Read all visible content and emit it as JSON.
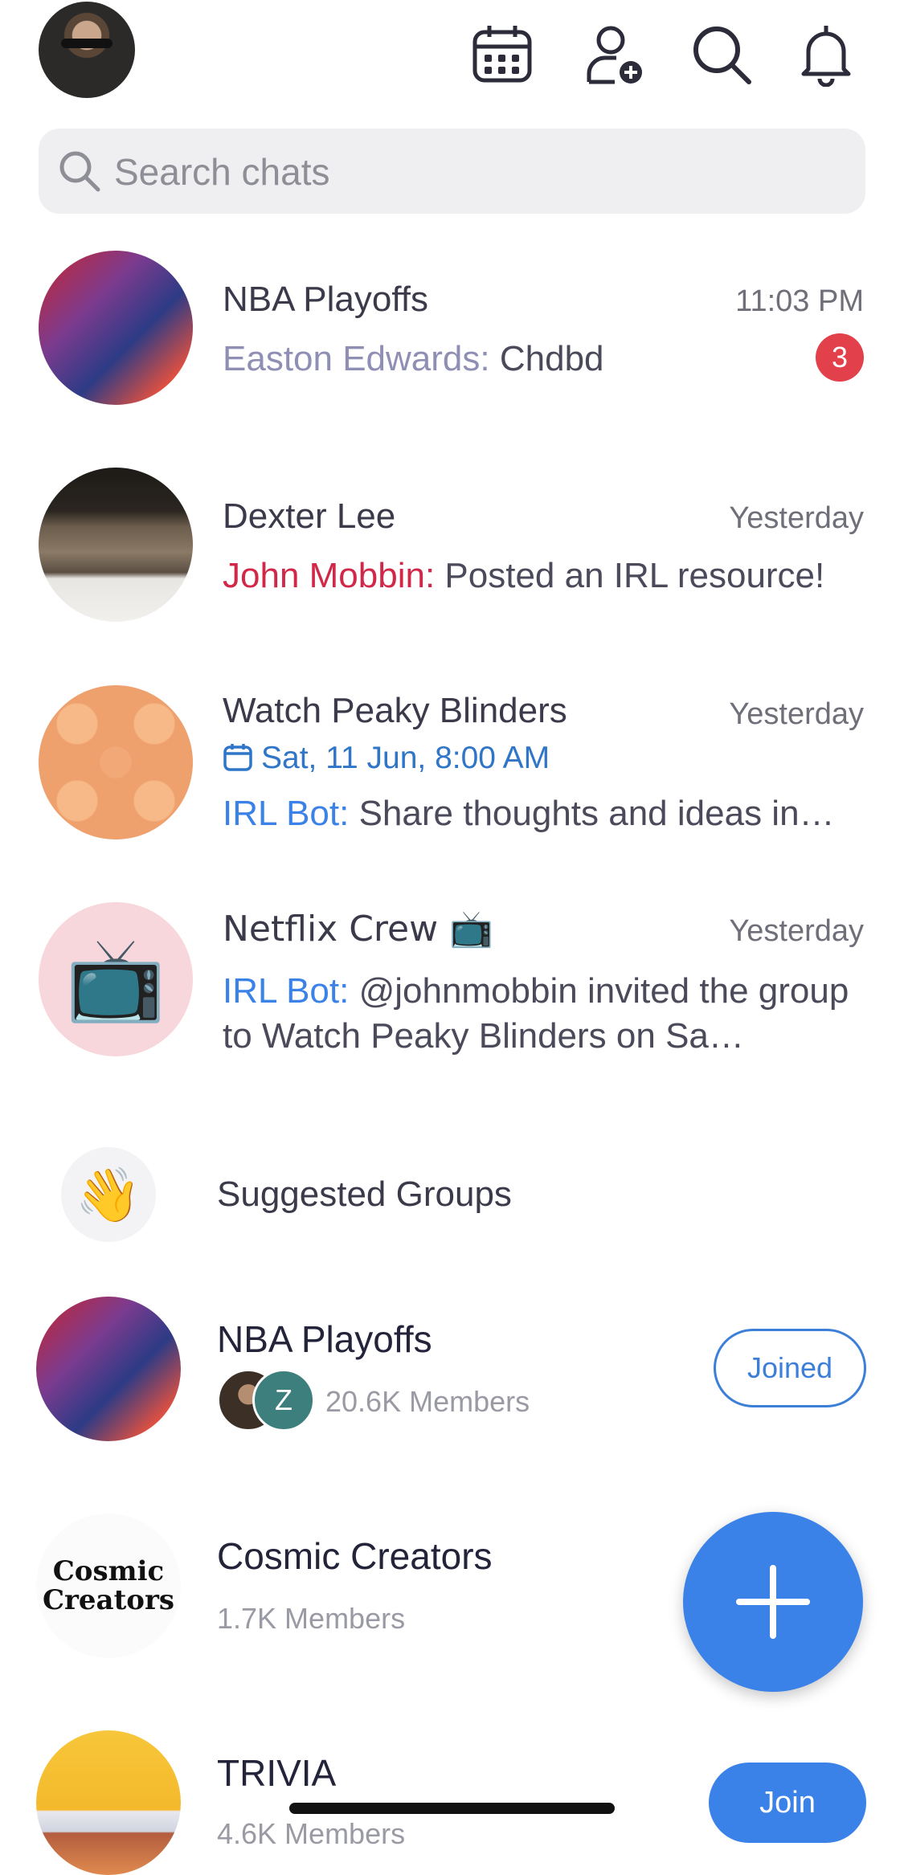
{
  "header": {
    "icons": [
      "calendar-icon",
      "add-user-icon",
      "search-icon",
      "bell-icon"
    ]
  },
  "search": {
    "placeholder": "Search chats"
  },
  "chats": [
    {
      "title": "NBA Playoffs",
      "time": "11:03 PM",
      "sender": "Easton Edwards:",
      "message": "Chdbd",
      "unread": "3",
      "sender_color": "#8f8fb5"
    },
    {
      "title": "Dexter Lee",
      "time": "Yesterday",
      "sender": "John Mobbin:",
      "message": "Posted an IRL resource!",
      "sender_color": "#d1284a"
    },
    {
      "title": "Watch Peaky Blinders",
      "time": "Yesterday",
      "event": "Sat, 11 Jun, 8:00 AM",
      "sender": "IRL Bot:",
      "message": "Share thoughts and ideas in…",
      "sender_color": "#3b82e8"
    },
    {
      "title": "Netflix Crew 📺",
      "time": "Yesterday",
      "sender": "IRL Bot:",
      "message": "@johnmobbin invited the group to Watch Peaky Blinders on Sa…",
      "sender_color": "#3b82e8",
      "avatar_emoji": "📺"
    }
  ],
  "suggested": {
    "label": "Suggested Groups",
    "emoji": "👋"
  },
  "groups": [
    {
      "name": "NBA Playoffs",
      "members": "20.6K Members",
      "mini_avatar_letter": "Z",
      "button": "Joined"
    },
    {
      "name": "Cosmic Creators",
      "members": "1.7K Members",
      "logo_line1": "Cosmic",
      "logo_line2": "Creators"
    },
    {
      "name": "TRIVIA",
      "members": "4.6K Members",
      "button": "Join"
    }
  ],
  "colors": {
    "accent": "#3b82e8",
    "badge": "#e2404a"
  }
}
